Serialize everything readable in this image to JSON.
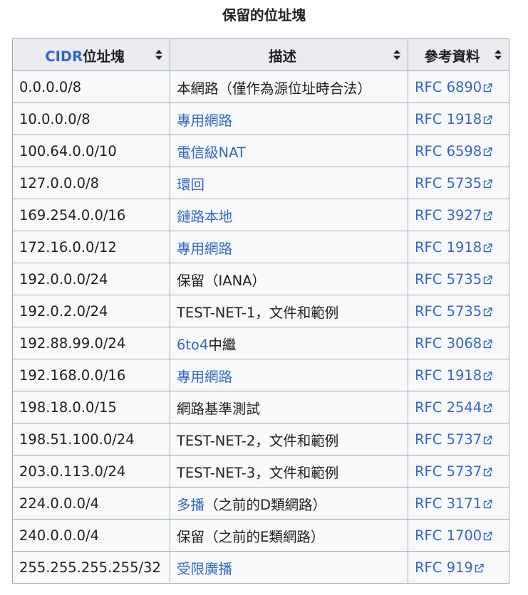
{
  "caption": "保留的位址塊",
  "headers": {
    "cidr_link": "CIDR",
    "cidr_rest": "位址塊",
    "description": "描述",
    "reference": "參考資料"
  },
  "icons": {
    "sort": "sort-icon",
    "external_link": "external-link-icon"
  },
  "colors": {
    "link": "#3366cc",
    "header_bg": "#eaecf0",
    "cell_bg": "#f8f9fa",
    "border": "#a2a9b1",
    "text": "#202122"
  },
  "rows": [
    {
      "cidr": "0.0.0.0/8",
      "desc": [
        {
          "text": "本網路（僅作為源位址時合法）",
          "link": false
        }
      ],
      "ref": "RFC 6890"
    },
    {
      "cidr": "10.0.0.0/8",
      "desc": [
        {
          "text": "專用網路",
          "link": true
        }
      ],
      "ref": "RFC 1918"
    },
    {
      "cidr": "100.64.0.0/10",
      "desc": [
        {
          "text": "電信級NAT",
          "link": true
        }
      ],
      "ref": "RFC 6598"
    },
    {
      "cidr": "127.0.0.0/8",
      "desc": [
        {
          "text": "環回",
          "link": true
        }
      ],
      "ref": "RFC 5735"
    },
    {
      "cidr": "169.254.0.0/16",
      "desc": [
        {
          "text": "鏈路本地",
          "link": true
        }
      ],
      "ref": "RFC 3927"
    },
    {
      "cidr": "172.16.0.0/12",
      "desc": [
        {
          "text": "專用網路",
          "link": true
        }
      ],
      "ref": "RFC 1918"
    },
    {
      "cidr": "192.0.0.0/24",
      "desc": [
        {
          "text": "保留（IANA）",
          "link": false
        }
      ],
      "ref": "RFC 5735"
    },
    {
      "cidr": "192.0.2.0/24",
      "desc": [
        {
          "text": "TEST-NET-1，文件和範例",
          "link": false
        }
      ],
      "ref": "RFC 5735"
    },
    {
      "cidr": "192.88.99.0/24",
      "desc": [
        {
          "text": "6to4",
          "link": true
        },
        {
          "text": "中繼",
          "link": false
        }
      ],
      "ref": "RFC 3068"
    },
    {
      "cidr": "192.168.0.0/16",
      "desc": [
        {
          "text": "專用網路",
          "link": true
        }
      ],
      "ref": "RFC 1918"
    },
    {
      "cidr": "198.18.0.0/15",
      "desc": [
        {
          "text": "網路基準測試",
          "link": false
        }
      ],
      "ref": "RFC 2544"
    },
    {
      "cidr": "198.51.100.0/24",
      "desc": [
        {
          "text": "TEST-NET-2，文件和範例",
          "link": false
        }
      ],
      "ref": "RFC 5737"
    },
    {
      "cidr": "203.0.113.0/24",
      "desc": [
        {
          "text": "TEST-NET-3，文件和範例",
          "link": false
        }
      ],
      "ref": "RFC 5737"
    },
    {
      "cidr": "224.0.0.0/4",
      "desc": [
        {
          "text": "多播",
          "link": true
        },
        {
          "text": "（之前的D類網路）",
          "link": false
        }
      ],
      "ref": "RFC 3171"
    },
    {
      "cidr": "240.0.0.0/4",
      "desc": [
        {
          "text": "保留（之前的E類網路）",
          "link": false
        }
      ],
      "ref": "RFC 1700"
    },
    {
      "cidr": "255.255.255.255/32",
      "desc": [
        {
          "text": "受限廣播",
          "link": true
        }
      ],
      "ref": "RFC 919"
    }
  ]
}
